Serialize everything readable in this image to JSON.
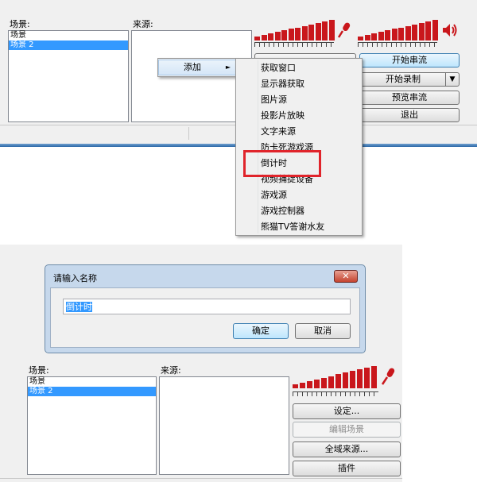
{
  "top": {
    "scenes_label": "场景:",
    "sources_label": "来源:",
    "scenes": [
      "场景",
      "场景 2"
    ],
    "buttons": {
      "start_stream": "开始串流",
      "start_record": "开始录制",
      "preview_stream": "预览串流",
      "exit": "退出"
    },
    "context_menu": {
      "add": "添加",
      "arrow": "►"
    },
    "submenu": [
      "获取窗口",
      "显示器获取",
      "图片源",
      "投影片放映",
      "文字来源",
      "防卡死游戏源",
      "倒计时",
      "视频捕捉设备",
      "游戏源",
      "游戏控制器",
      "熊猫TV答谢水友"
    ],
    "highlighted_item": "倒计时"
  },
  "dialog": {
    "title": "请输入名称",
    "input_value": "倒计时",
    "ok": "确定",
    "cancel": "取消"
  },
  "bottom": {
    "scenes_label": "场景:",
    "sources_label": "来源:",
    "scenes": [
      "场景",
      "场景 2"
    ],
    "buttons": {
      "settings": "设定...",
      "edit_scene": "编辑场景",
      "global_sources": "全域来源...",
      "plugins": "插件"
    }
  },
  "colors": {
    "meter": "#c9171c",
    "selection": "#3399ff",
    "highlight": "#e0242b"
  },
  "icons": {
    "mic": "microphone-icon",
    "speaker": "speaker-icon",
    "close": "close-icon",
    "dropdown": "dropdown-arrow-icon"
  }
}
